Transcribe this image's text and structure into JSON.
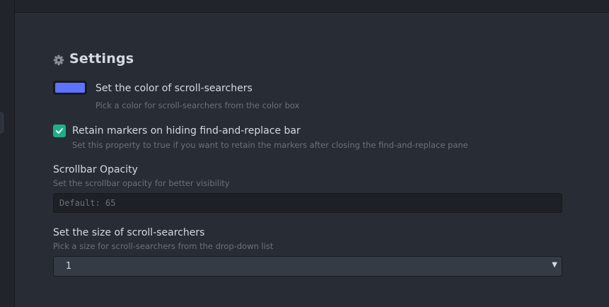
{
  "settings": {
    "title": "Settings",
    "icon": "gear-icon"
  },
  "color_setting": {
    "label": "Set the color of scroll-searchers",
    "description": "Pick a color for scroll-searchers from the color box",
    "value": "#5d72ff"
  },
  "retain_markers": {
    "label": "Retain markers on hiding find-and-replace bar",
    "description": "Set this property to true if you want to retain the markers after closing the find-and-replace pane",
    "checked": true
  },
  "scrollbar_opacity": {
    "label": "Scrollbar Opacity",
    "description": "Set the scrollbar opacity for better visibility",
    "placeholder": "Default: 65",
    "value": ""
  },
  "searcher_size": {
    "label": "Set the size of scroll-searchers",
    "description": "Pick a size for scroll-searchers from the drop-down list",
    "selected": "1"
  },
  "colors": {
    "accent_check": "#1fae8c",
    "background": "#282c34"
  }
}
